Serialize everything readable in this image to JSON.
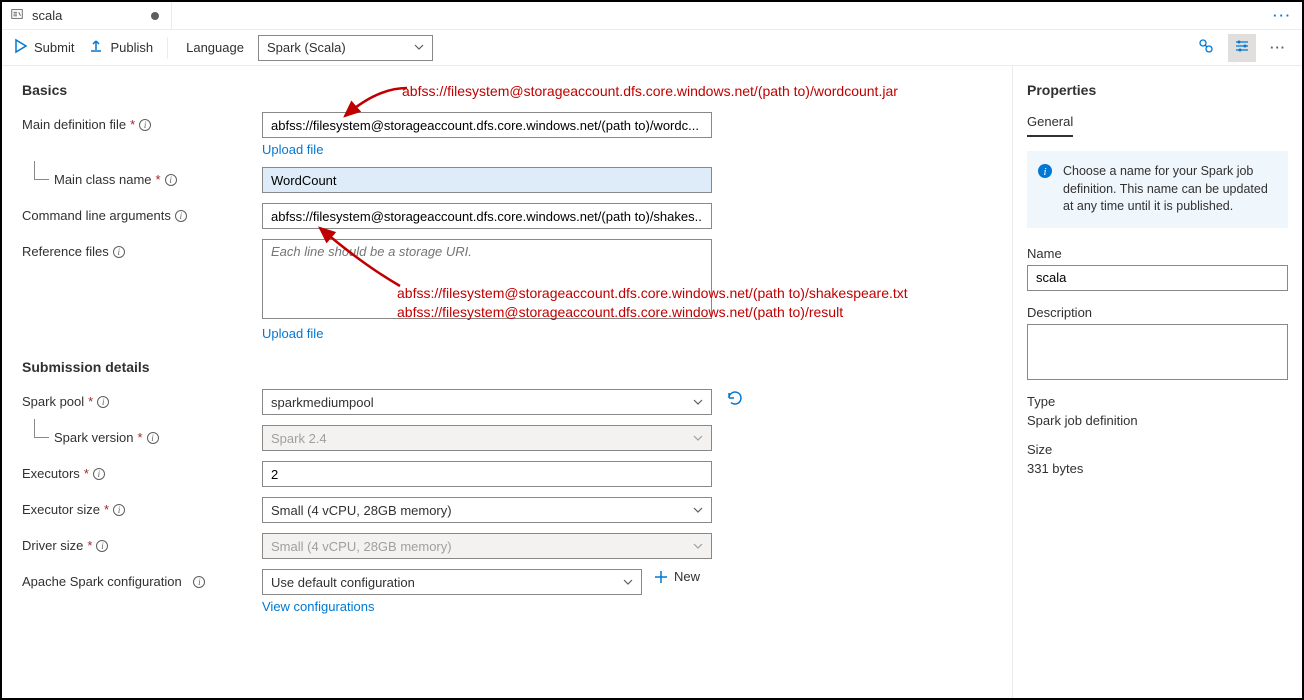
{
  "tab": {
    "label": "scala"
  },
  "toolbar": {
    "submit": "Submit",
    "publish": "Publish",
    "language_label": "Language",
    "language_value": "Spark (Scala)"
  },
  "basics": {
    "heading": "Basics",
    "main_def_label": "Main definition file",
    "main_def_value": "abfss://filesystem@storageaccount.dfs.core.windows.net/(path to)/wordc...",
    "upload_file": "Upload file",
    "main_class_label": "Main class name",
    "main_class_value": "WordCount",
    "cli_args_label": "Command line arguments",
    "cli_args_value": "abfss://filesystem@storageaccount.dfs.core.windows.net/(path to)/shakes...",
    "ref_files_label": "Reference files",
    "ref_files_placeholder": "Each line should be a storage URI.",
    "upload_file2": "Upload file"
  },
  "submission": {
    "heading": "Submission details",
    "pool_label": "Spark pool",
    "pool_value": "sparkmediumpool",
    "version_label": "Spark version",
    "version_value": "Spark 2.4",
    "executors_label": "Executors",
    "executors_value": "2",
    "exec_size_label": "Executor size",
    "exec_size_value": "Small (4 vCPU, 28GB memory)",
    "driver_size_label": "Driver size",
    "driver_size_value": "Small (4 vCPU, 28GB memory)",
    "spark_conf_label": "Apache Spark configuration",
    "spark_conf_value": "Use default configuration",
    "new_label": "New",
    "view_conf": "View configurations"
  },
  "annotations": {
    "a1": "abfss://filesystem@storageaccount.dfs.core.windows.net/(path to)/wordcount.jar",
    "a2": "abfss://filesystem@storageaccount.dfs.core.windows.net/(path to)/shakespeare.txt",
    "a3": "abfss://filesystem@storageaccount.dfs.core.windows.net/(path to)/result"
  },
  "properties": {
    "heading": "Properties",
    "tab": "General",
    "callout": "Choose a name for your Spark job definition. This name can be updated at any time until it is published.",
    "name_label": "Name",
    "name_value": "scala",
    "desc_label": "Description",
    "type_label": "Type",
    "type_value": "Spark job definition",
    "size_label": "Size",
    "size_value": "331 bytes"
  }
}
